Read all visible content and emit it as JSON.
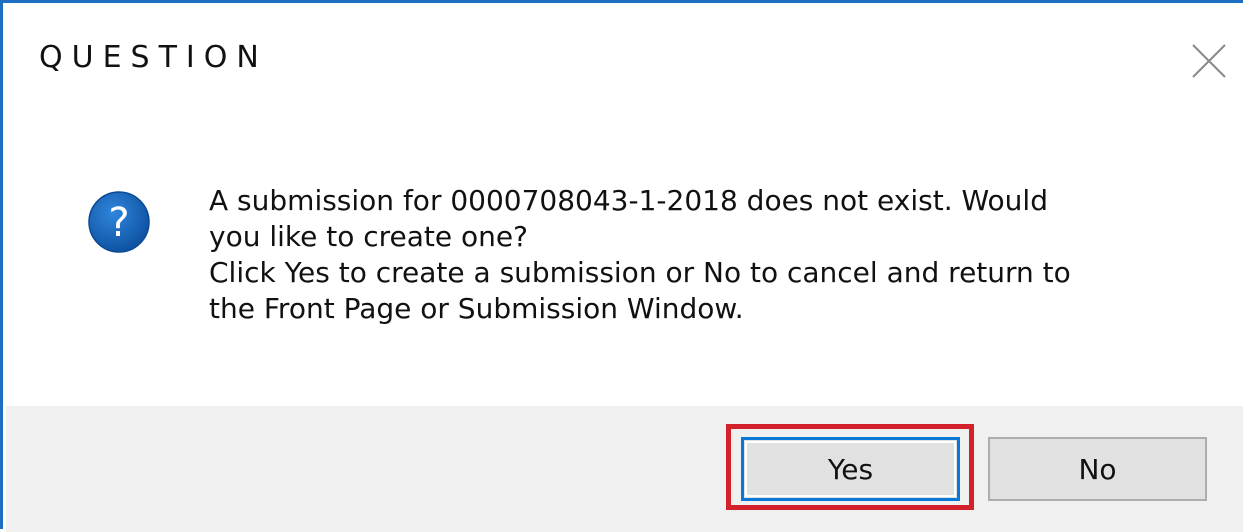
{
  "dialog": {
    "title": "QUESTION",
    "close_icon": "close-icon",
    "question_icon": "question-mark-icon",
    "message_lines": [
      "A submission for 0000708043-1-2018 does not exist. Would",
      "you like to create one?",
      "Click Yes to create a submission or No to cancel and return to",
      "the Front Page or Submission Window."
    ],
    "buttons": {
      "yes_label": "Yes",
      "no_label": "No"
    },
    "colors": {
      "accent_border": "#1e6fc1",
      "icon_blue": "#1565c0",
      "highlight_red": "#d3202a",
      "footer_bg": "#f0f0f0"
    }
  }
}
